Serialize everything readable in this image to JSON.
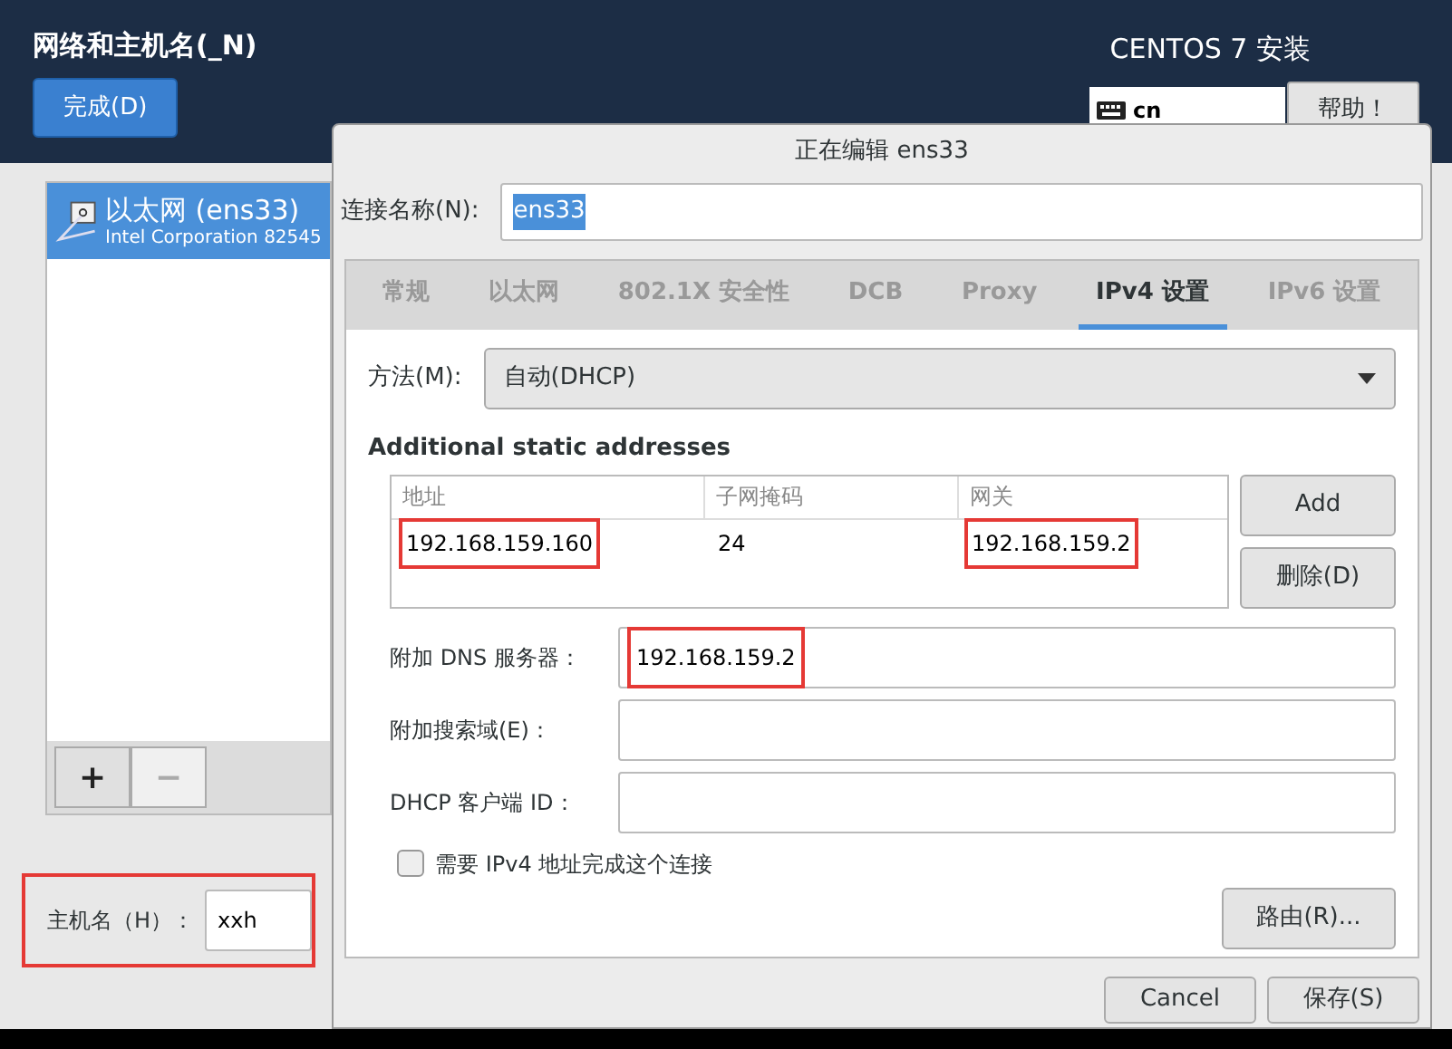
{
  "header": {
    "title": "网络和主机名(_N)",
    "done_button": "完成(D)",
    "product": "CENTOS 7 安装",
    "keyboard_layout": "cn",
    "help_button": "帮助！"
  },
  "devices": [
    {
      "name": "以太网 (ens33)",
      "description": "Intel Corporation 82545",
      "selected": true
    }
  ],
  "device_buttons": [
    {
      "label": "+",
      "disabled": false
    },
    {
      "label": "−",
      "disabled": true
    }
  ],
  "hostname": {
    "label": "主机名（H）：",
    "value": "xxh",
    "highlighted": true
  },
  "dialog": {
    "title": "正在编辑 ens33",
    "connection_name_label": "连接名称(N):",
    "connection_name": "ens33",
    "tabs": [
      {
        "label": "常规",
        "selected": false
      },
      {
        "label": "以太网",
        "selected": false
      },
      {
        "label": "802.1X 安全性",
        "selected": false
      },
      {
        "label": "DCB",
        "selected": false
      },
      {
        "label": "Proxy",
        "selected": false
      },
      {
        "label": "IPv4 设置",
        "selected": true
      },
      {
        "label": "IPv6 设置",
        "selected": false
      }
    ],
    "method_label": "方法(M):",
    "method": "自动(DHCP)",
    "addresses_heading": "Additional static addresses",
    "address_columns": [
      "地址",
      "子网掩码",
      "网关"
    ],
    "address_rows": [
      {
        "cells": [
          {
            "text": "192.168.159.160",
            "highlighted": true
          },
          {
            "text": "24",
            "highlighted": false
          },
          {
            "text": "192.168.159.2",
            "highlighted": true
          }
        ]
      }
    ],
    "address_buttons": [
      "Add",
      "删除(D)"
    ],
    "fields": [
      {
        "label": "附加 DNS 服务器：",
        "value": "192.168.159.2",
        "highlighted": true
      },
      {
        "label": "附加搜索域(E)："
      },
      {
        "label": "DHCP 客户端 ID："
      }
    ],
    "require_ipv4": {
      "label": "需要 IPv4 地址完成这个连接",
      "checked": false
    },
    "routes_button": "路由(R)...",
    "footer_buttons": [
      "Cancel",
      "保存(S)"
    ]
  }
}
